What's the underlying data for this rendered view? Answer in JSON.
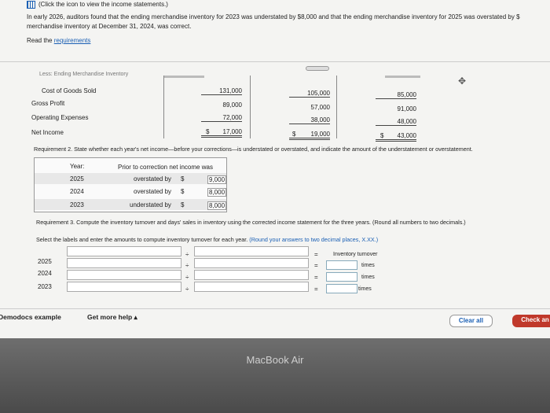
{
  "header": {
    "click_text": "(Click the icon to view the income statements.)",
    "intro_line1": "In early 2026, auditors found that the ending merchandise inventory for 2023 was understated by $8,000 and that the ending merchandise inventory for 2025 was overstated by $",
    "intro_line2": "merchandise inventory at December 31, 2024, was correct.",
    "read_prefix": "Read the ",
    "read_link": "requirements"
  },
  "income_statement": {
    "less_label": "Less: Ending Merchandise Inventory",
    "cogs_label": "Cost of Goods Sold",
    "gross_label": "Gross Profit",
    "opex_label": "Operating Expenses",
    "ni_label": "Net Income",
    "dollar": "$",
    "cogs": [
      "131,000",
      "105,000",
      "85,000"
    ],
    "gross": [
      "89,000",
      "57,000",
      "91,000"
    ],
    "opex": [
      "72,000",
      "38,000",
      "48,000"
    ],
    "ni": [
      "17,000",
      "19,000",
      "43,000"
    ]
  },
  "req2": {
    "text": "Requirement 2. State whether each year's net income—before your corrections—is understated or overstated, and indicate the amount of the understatement or overstatement.",
    "year_header": "Year:",
    "prior_header": "Prior to correction net income was",
    "rows": [
      {
        "year": "2025",
        "status": "overstated by",
        "dollar": "$",
        "amount": "9,000"
      },
      {
        "year": "2024",
        "status": "overstated by",
        "dollar": "$",
        "amount": "8,000"
      },
      {
        "year": "2023",
        "status": "understated by",
        "dollar": "$",
        "amount": "8,000"
      }
    ]
  },
  "req3": {
    "text": "Requirement 3. Compute the inventory turnover and days' sales in inventory using the corrected income statement for the three years. (Round all numbers to two decimals.)",
    "instruction_plain": "Select the labels and enter the amounts to compute inventory turnover for each year. ",
    "instruction_blue": "(Round your answers to two decimal places, X.XX.)",
    "turnover_header": "Inventory turnover",
    "divide": "÷",
    "equals": "=",
    "times": "times",
    "years": [
      "2025",
      "2024",
      "2023"
    ]
  },
  "footer": {
    "demodocs": "Demodocs example",
    "help": "Get more help",
    "help_caret": "▴",
    "clear": "Clear all",
    "check": "Check an"
  },
  "bezel": {
    "brand": "MacBook Air"
  }
}
